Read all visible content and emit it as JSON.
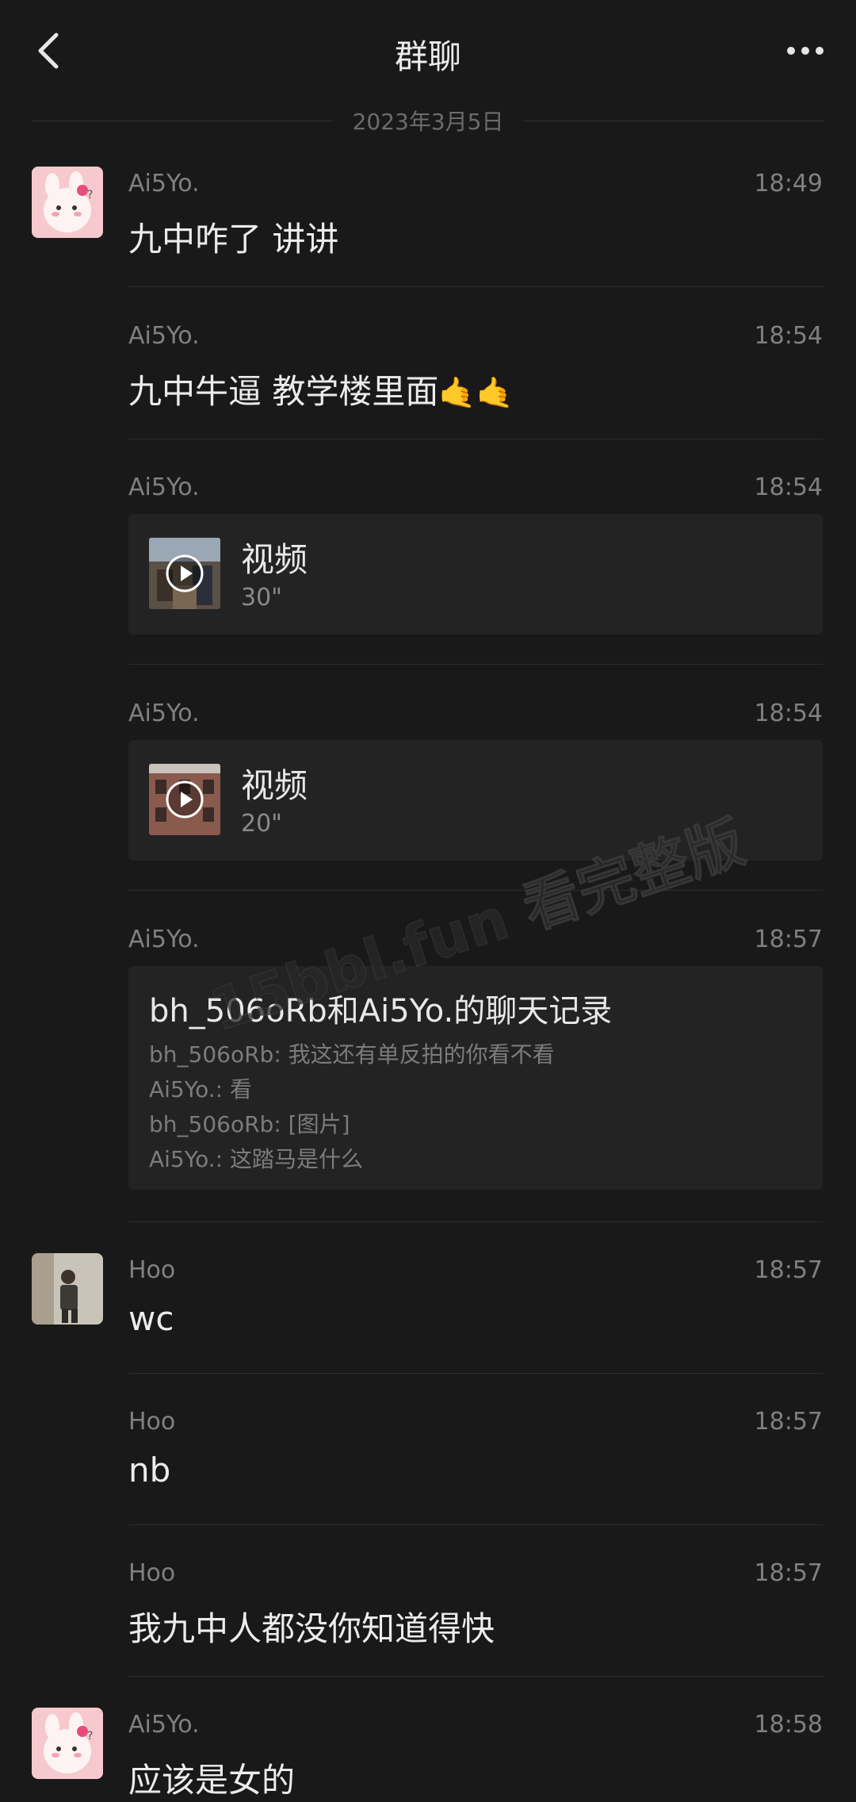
{
  "header": {
    "title": "群聊"
  },
  "date_divider": "2023年3月5日",
  "messages": [
    {
      "sender": "Ai5Yo.",
      "time": "18:49",
      "type": "text",
      "text": "九中咋了 讲讲",
      "avatar": "bunny-avatar"
    },
    {
      "sender": "Ai5Yo.",
      "time": "18:54",
      "type": "text",
      "text": "九中牛逼 教学楼里面",
      "emoji": "🤙🤙"
    },
    {
      "sender": "Ai5Yo.",
      "time": "18:54",
      "type": "video",
      "label": "视频",
      "duration": "30\""
    },
    {
      "sender": "Ai5Yo.",
      "time": "18:54",
      "type": "video",
      "label": "视频",
      "duration": "20\""
    },
    {
      "sender": "Ai5Yo.",
      "time": "18:57",
      "type": "chat_record",
      "title": "bh_506oRb和Ai5Yo.的聊天记录",
      "lines": [
        "bh_506oRb: 我这还有单反拍的你看不看",
        "Ai5Yo.: 看",
        "bh_506oRb: [图片]",
        "Ai5Yo.: 这踏马是什么"
      ]
    },
    {
      "sender": "Hoo",
      "time": "18:57",
      "type": "text",
      "text": "wc",
      "avatar": "person-avatar"
    },
    {
      "sender": "Hoo",
      "time": "18:57",
      "type": "text",
      "text": "nb"
    },
    {
      "sender": "Hoo",
      "time": "18:57",
      "type": "text",
      "text": "我九中人都没你知道得快"
    },
    {
      "sender": "Ai5Yo.",
      "time": "18:58",
      "type": "text",
      "text": "应该是女的",
      "avatar": "bunny-avatar"
    }
  ],
  "watermark": "15bbl.fun 看完整版",
  "colors": {
    "background": "#191919",
    "card": "#232323",
    "meta_text": "#808080",
    "body_text": "#ececec"
  }
}
